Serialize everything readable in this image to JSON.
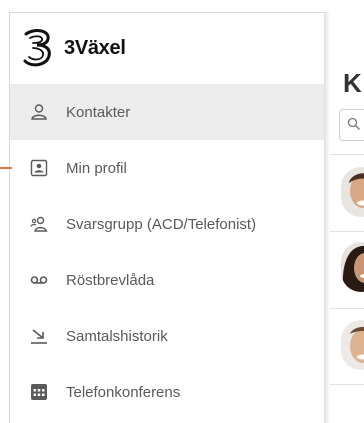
{
  "brand": {
    "name": "3Växel",
    "logo_icon": "three-logo-icon"
  },
  "sidebar": {
    "items": [
      {
        "label": "Kontakter",
        "icon": "person-icon",
        "active": true
      },
      {
        "label": "Min profil",
        "icon": "profile-card-icon",
        "active": false
      },
      {
        "label": "Svarsgrupp (ACD/Telefonist)",
        "icon": "group-icon",
        "active": false
      },
      {
        "label": "Röstbrevlåda",
        "icon": "voicemail-icon",
        "active": false
      },
      {
        "label": "Samtalshistorik",
        "icon": "call-history-icon",
        "active": false
      },
      {
        "label": "Telefonkonferens",
        "icon": "conference-icon",
        "active": false
      }
    ]
  },
  "main": {
    "title_partial": "K",
    "search_icon": "search-icon",
    "contacts": [
      {
        "avatar": "avatar-1"
      },
      {
        "avatar": "avatar-2"
      },
      {
        "avatar": "avatar-3"
      }
    ]
  },
  "colors": {
    "accent": "#e0763a",
    "active_bg": "#ececec",
    "text": "#5a5a5a"
  }
}
